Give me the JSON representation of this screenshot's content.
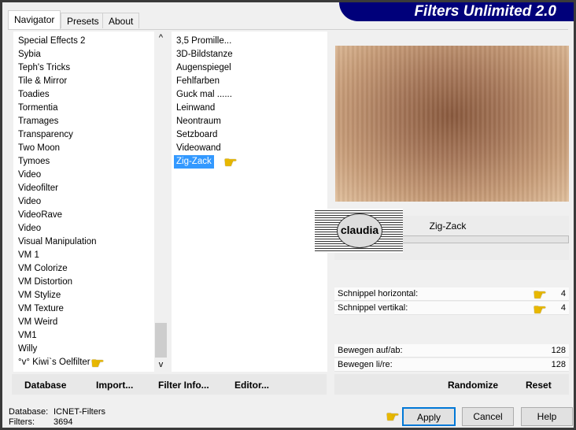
{
  "title": "Filters Unlimited 2.0",
  "tabs": [
    "Navigator",
    "Presets",
    "About"
  ],
  "categories": [
    "Special Effects 2",
    "Sybia",
    "Teph's Tricks",
    "Tile & Mirror",
    "Toadies",
    "Tormentia",
    "Tramages",
    "Transparency",
    "Two Moon",
    "Tymoes",
    "Video",
    "Videofilter",
    "Video",
    "VideoRave",
    "Video",
    "Visual Manipulation",
    "VM 1",
    "VM Colorize",
    "VM Distortion",
    "VM Stylize",
    "VM Texture",
    "VM Weird",
    "VM1",
    "Willy",
    "°v° Kiwi`s Oelfilter"
  ],
  "filters": [
    "3,5 Promille...",
    "3D-Bildstanze",
    "Augenspiegel",
    "Fehlfarben",
    "Guck mal ......",
    "Leinwand",
    "Neontraum",
    "Setzboard",
    "Videowand",
    "Zig-Zack"
  ],
  "selected_filter": "Zig-Zack",
  "filter_name": "Zig-Zack",
  "watermark": "claudia",
  "params": [
    {
      "label": "Schnippel horizontal:",
      "value": "4"
    },
    {
      "label": "Schnippel vertikal:",
      "value": "4"
    },
    {
      "label": "Bewegen auf/ab:",
      "value": "128"
    },
    {
      "label": "Bewegen li/re:",
      "value": "128"
    }
  ],
  "left_buttons": [
    "Database",
    "Import...",
    "Filter Info...",
    "Editor..."
  ],
  "right_buttons": [
    "Randomize",
    "Reset"
  ],
  "status": {
    "db_label": "Database:",
    "db_value": "ICNET-Filters",
    "filters_label": "Filters:",
    "filters_value": "3694"
  },
  "dialog_buttons": {
    "apply": "Apply",
    "cancel": "Cancel",
    "help": "Help"
  },
  "scroll": {
    "up": "^",
    "down": "v"
  }
}
